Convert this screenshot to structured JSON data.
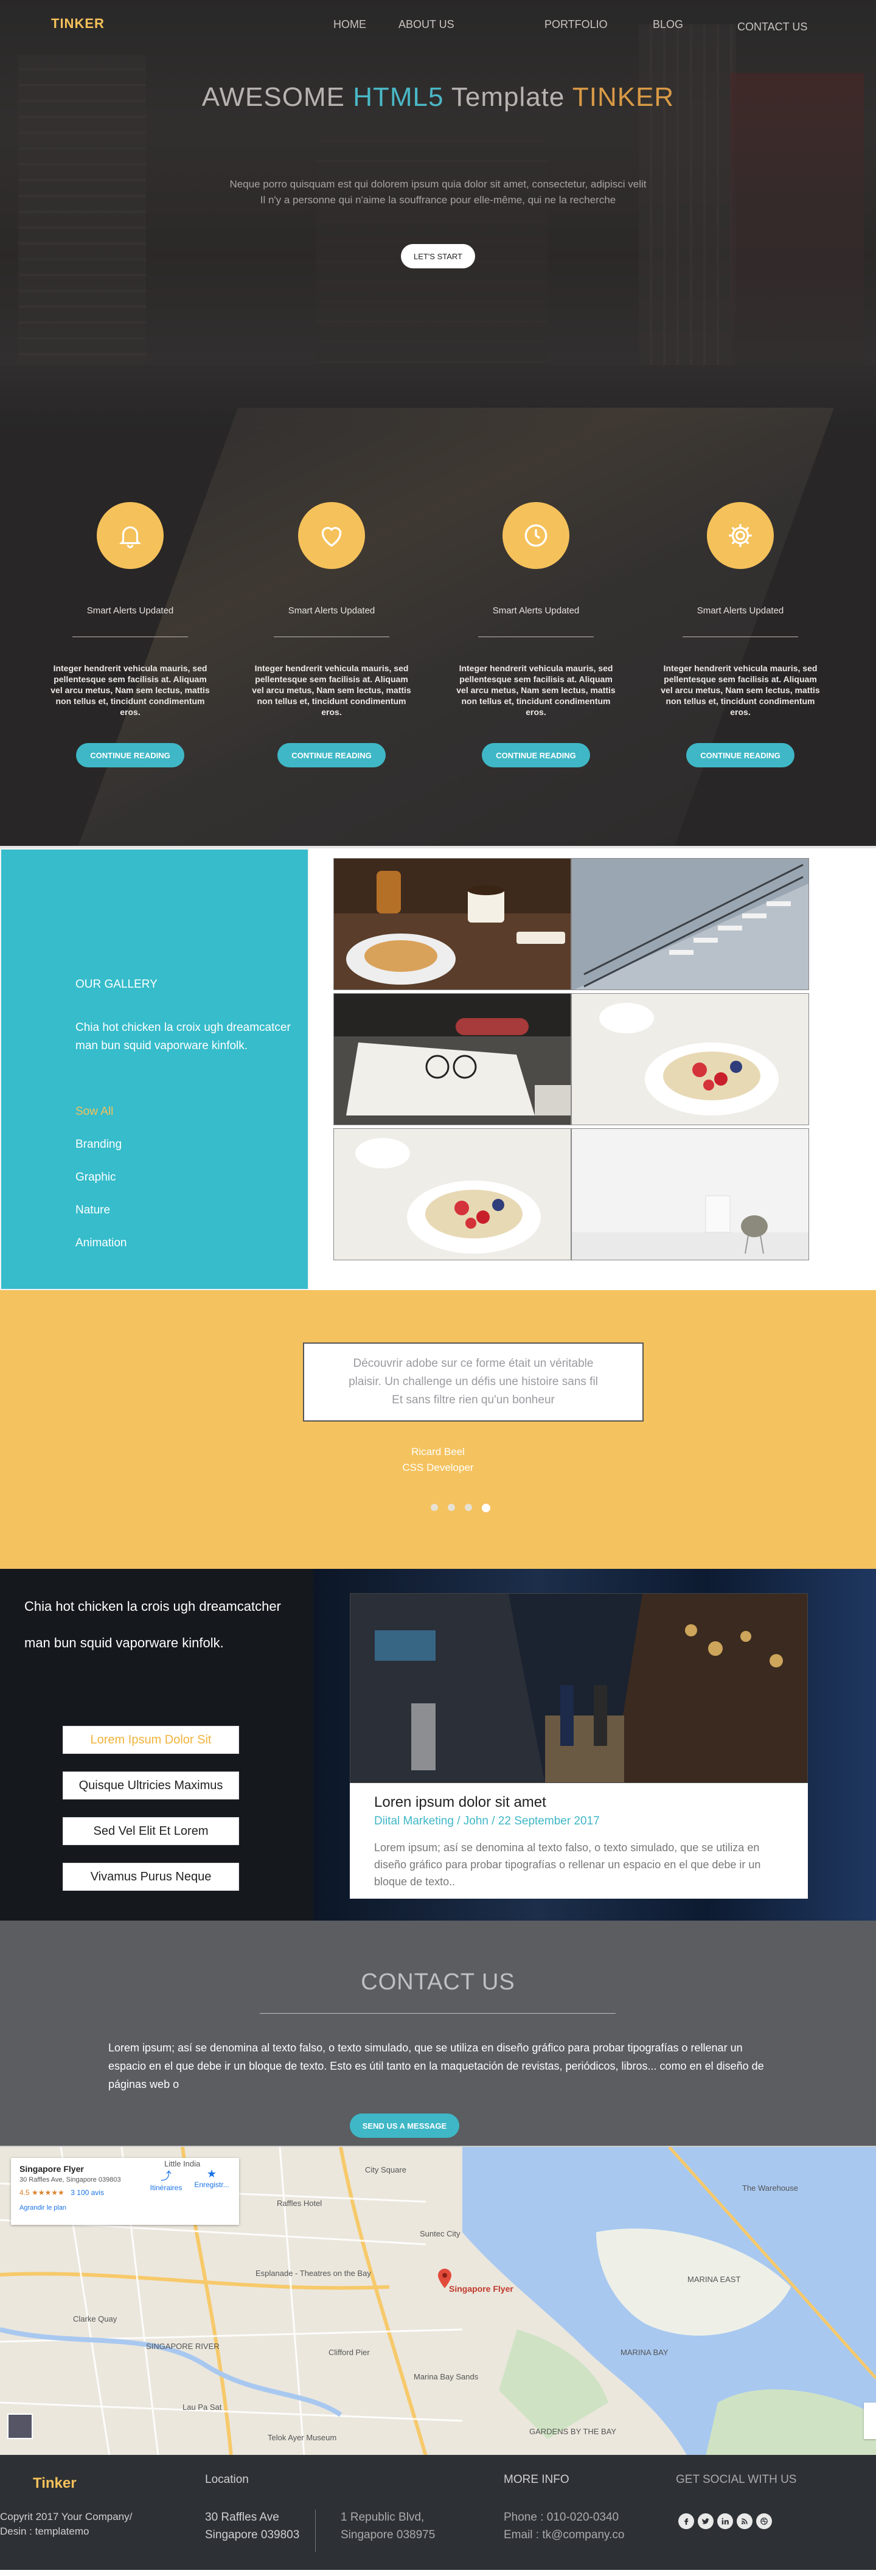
{
  "nav": {
    "logo": "TINKER",
    "links": [
      "HOME",
      "ABOUT US",
      "PORTFOLIO",
      "BLOG",
      "CONTACT US"
    ]
  },
  "hero": {
    "title_a": "AWESOME ",
    "title_b": "HTML5",
    "title_c": " Template ",
    "title_d": "TINKER",
    "sub_1": "Neque porro quisquam est qui dolorem ipsum quia dolor sit amet, consectetur, adipisci velit",
    "sub_2": "Il n'y a personne qui n'aime la souffrance pour elle-même, qui ne la recherche",
    "button": "LET'S START"
  },
  "features": [
    {
      "icon": "bell-icon",
      "title": "Smart Alerts Updated",
      "text": "Integer hendrerit vehicula mauris, sed pellentesque sem facilisis at. Aliquam vel arcu metus, Nam sem lectus, mattis non tellus et, tincidunt condimentum eros.",
      "button": "CONTINUE READING"
    },
    {
      "icon": "heart-icon",
      "title": "Smart Alerts Updated",
      "text": "Integer hendrerit vehicula mauris, sed pellentesque sem facilisis at. Aliquam vel arcu metus, Nam sem lectus, mattis non tellus et, tincidunt condimentum eros.",
      "button": "CONTINUE READING"
    },
    {
      "icon": "clock-icon",
      "title": "Smart Alerts Updated",
      "text": "Integer hendrerit vehicula mauris, sed pellentesque sem facilisis at. Aliquam vel arcu metus, Nam sem lectus, mattis non tellus et, tincidunt condimentum eros.",
      "button": "CONTINUE READING"
    },
    {
      "icon": "gear-icon",
      "title": "Smart Alerts Updated",
      "text": "Integer hendrerit vehicula mauris, sed pellentesque sem facilisis at. Aliquam vel arcu metus, Nam sem lectus, mattis non tellus et, tincidunt condimentum eros.",
      "button": "CONTINUE READING"
    }
  ],
  "gallery": {
    "title": "OUR GALLERY",
    "desc": "Chia hot chicken la croix ugh dreamcatcer man bun squid vaporware kinfolk.",
    "filters": [
      "Sow All",
      "Branding",
      "Graphic",
      "Nature",
      "Animation"
    ],
    "active_filter": "Sow All"
  },
  "testimonial": {
    "quote_1": "Découvrir adobe sur ce forme était un véritable",
    "quote_2": "plaisir. Un challenge un défis une histoire sans fil",
    "quote_3": "Et sans filtre rien qu'un bonheur",
    "name": "Ricard Beel",
    "role": "CSS Developer"
  },
  "blog": {
    "heading_1": "Chia hot chicken la crois ugh dreamcatcher",
    "heading_2": "man  bun squid vaporware kinfolk.",
    "buttons": [
      "Lorem Ipsum Dolor Sit",
      "Quisque Ultricies Maximus",
      "Sed Vel Elit Et Lorem",
      "Vivamus Purus Neque"
    ],
    "card_title": "Loren ipsum dolor sit amet",
    "card_meta": "Diital Marketing / John / 22 September 2017",
    "card_text": "Lorem ipsum; así se denomina al texto falso, o texto simulado, que se utiliza en diseño gráfico para probar tipografías o rellenar un espacio en el que debe ir un bloque de texto.."
  },
  "contact": {
    "title": "CONTACT US",
    "text": "Lorem ipsum; así se denomina al texto falso, o texto simulado, que se utiliza en diseño gráfico para probar tipografías o rellenar un espacio en el que debe ir un bloque de texto. Esto es útil tanto en la maquetación de revistas, periódicos, libros... como en el diseño de páginas web o",
    "button": "SEND US A MESSAGE"
  },
  "map": {
    "place": "Singapore Flyer",
    "address": "30 Raffles Ave, Singapore 039803",
    "rating": "4.5 ★★★★★",
    "reviews": "3 100 avis",
    "enlarge": "Agrandir le plan",
    "action_1": "Itinéraires",
    "action_2": "Enregistr...",
    "pin_label": "Singapore Flyer",
    "labels": [
      "Raffles Hotel",
      "Suntec City",
      "MARINA EAST",
      "MARINA BAY",
      "Clarke Quay",
      "Marina Bay Sands",
      "GARDENS BY THE BAY",
      "The Warehouse",
      "City Square",
      "Little India",
      "Esplanade - Theatres on the Bay",
      "SINGAPORE RIVER",
      "Clifford Pier",
      "Telok Ayer Museum",
      "Lau Pa Sat"
    ]
  },
  "footer": {
    "logo": "Tinker",
    "copy_1": "Copyrit   2017 Your Company/",
    "copy_2": "Desin : templatemo",
    "location_head": "Location",
    "loc1_a": "30 Raffles Ave",
    "loc1_b": "Singapore 039803",
    "loc2_a": "1 Republic Blvd,",
    "loc2_b": "Singapore 038975",
    "more_head": "MORE INFO",
    "phone": "Phone : 010-020-0340",
    "email": "Email   : tk@company.co",
    "social_head": "GET SOCIAL WITH US",
    "social": [
      "facebook-icon",
      "twitter-icon",
      "linkedin-icon",
      "rss-icon",
      "dribbble-icon"
    ]
  },
  "colors": {
    "accent_gold": "#f5c15a",
    "accent_teal": "#3fb7c6",
    "testimonial_bg": "#f4c25e"
  }
}
